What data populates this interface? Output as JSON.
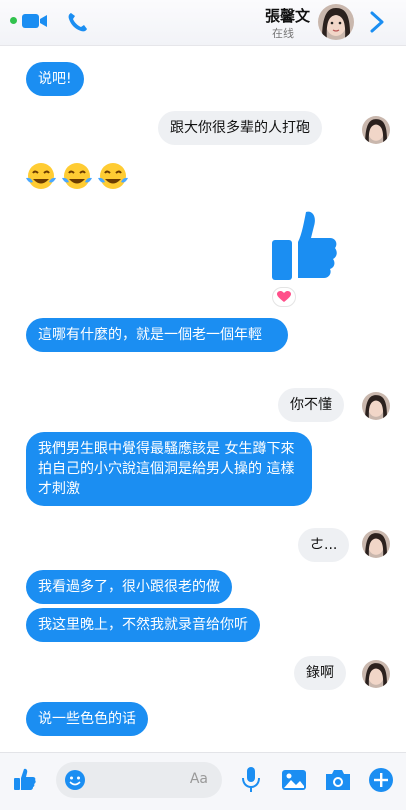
{
  "header": {
    "name": "張馨文",
    "status": "在线",
    "phone_icon": "phone-icon",
    "video_icon": "video-camera-icon",
    "back_icon": "chevron-right-icon"
  },
  "messages": [
    {
      "side": "blue",
      "text": "说吧!"
    },
    {
      "side": "gray",
      "text": "跟大你很多辈的人打砲"
    },
    {
      "side": "emoji",
      "text": "😂😂😂"
    },
    {
      "side": "sticker",
      "text": "thumbs-up"
    },
    {
      "side": "blue",
      "text": "這哪有什麼的，就是一個老一個年輕"
    },
    {
      "side": "gray",
      "text": "你不懂"
    },
    {
      "side": "blue",
      "text": "我們男生眼中覺得最騷應該是 女生蹲下來拍自己的小穴說這個洞是給男人操的 這樣才刺激"
    },
    {
      "side": "gray",
      "text": "ㄜ..."
    },
    {
      "side": "blue",
      "text": "我看過多了，很小跟很老的做"
    },
    {
      "side": "blue",
      "text": "我这里晚上，不然我就录音给你听"
    },
    {
      "side": "gray",
      "text": "錄啊"
    },
    {
      "side": "blue",
      "text": "说一些色色的话"
    }
  ],
  "composer": {
    "placeholder": "Aa",
    "colors": {
      "accent": "#1b8ef2",
      "bubble_gray": "#eef0f3"
    }
  }
}
